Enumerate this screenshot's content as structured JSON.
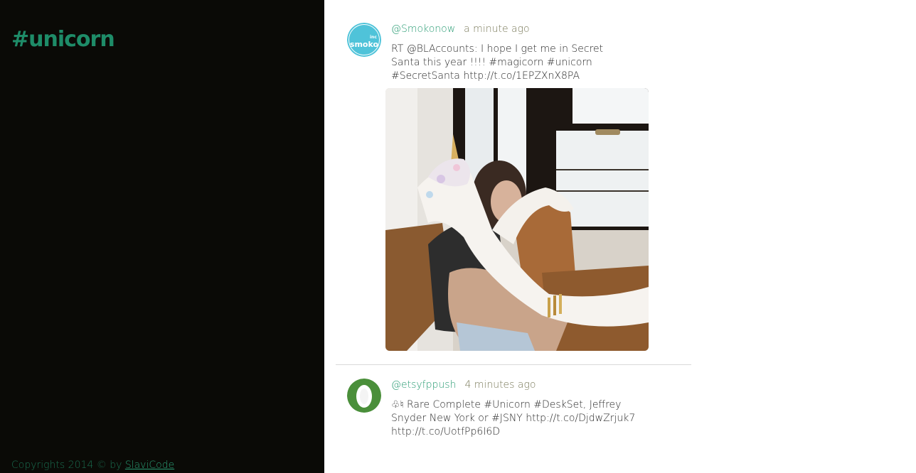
{
  "page": {
    "hashtag": "#unicorn",
    "copyright_prefix": "Copyrights 2014 © by ",
    "copyright_link": "SlaviCode"
  },
  "tweets": [
    {
      "username": "@Smokonow",
      "time": "a minute ago",
      "text": "RT @BLAccounts: I hope I get me in Secret Santa this year !!!! #magicorn #unicorn #SecretSanta http://t.co/1EPZXnX8PA",
      "avatar_text_small": "inc",
      "avatar_text": "smoko",
      "avatar_color": "#4fc3d9"
    },
    {
      "username": "@etsyfppush",
      "time": "4 minutes ago",
      "text": "♧♮ Rare Complete #Unicorn #DeskSet, Jeffrey Snyder New York or #JSNY http://t.co/DjdwZrjuk7 http://t.co/UotfPp6I6D",
      "avatar_color": "#4a8f3a"
    }
  ],
  "colors": {
    "sidebar_bg": "#0a0a06",
    "accent": "#1e8c68",
    "link": "#2a9c74"
  }
}
